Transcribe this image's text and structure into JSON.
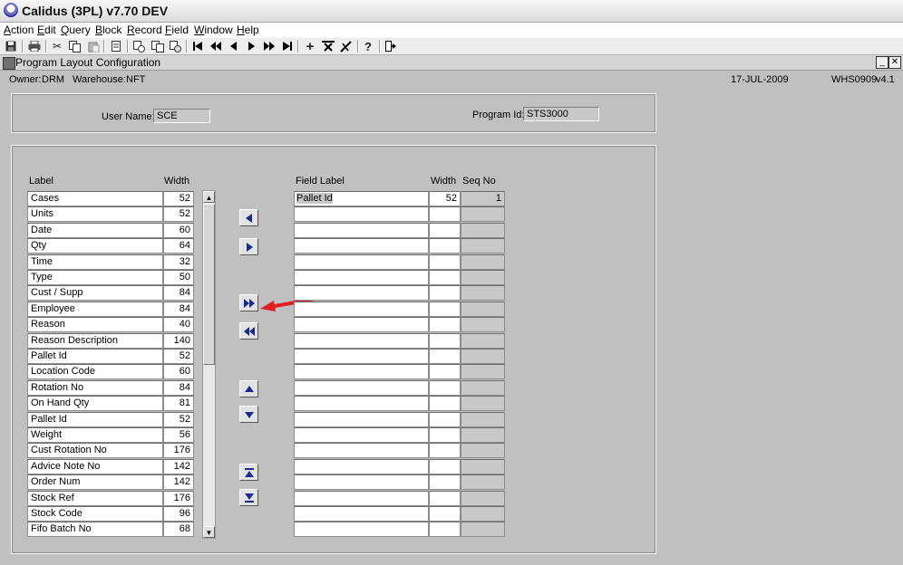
{
  "window": {
    "title": "Calidus (3PL) v7.70 DEV"
  },
  "menu": [
    "Action",
    "Edit",
    "Query",
    "Block",
    "Record",
    "Field",
    "Window",
    "Help"
  ],
  "toolbar_icons": [
    "save-icon",
    "print-icon",
    "cut-icon",
    "copy-icon",
    "paste-icon",
    "clear-icon",
    "duplicate-icon",
    "copy-record-icon",
    "paste-record-icon",
    "first-record-icon",
    "previous-set-icon",
    "previous-record-icon",
    "next-record-icon",
    "next-set-icon",
    "last-record-icon",
    "insert-record-icon",
    "delete-record-icon",
    "edit-icon",
    "help-icon",
    "exit-icon"
  ],
  "form": {
    "title": "Program Layout Configuration",
    "owner_label": "Owner:",
    "owner": "DRM",
    "warehouse_label": "Warehouse:",
    "warehouse": "NFT",
    "date": "17-JUL-2009",
    "form_id": "WHS0909",
    "version": "v4.1",
    "user_name_label": "User Name:",
    "user_name": "SCE",
    "program_id_label": "Program Id:",
    "program_id": "STS3000"
  },
  "available": {
    "headers": {
      "label": "Label",
      "width": "Width"
    },
    "rows": [
      {
        "label": "Cases",
        "width": "52"
      },
      {
        "label": "Units",
        "width": "52"
      },
      {
        "label": "Date",
        "width": "60"
      },
      {
        "label": "Qty",
        "width": "64"
      },
      {
        "label": "Time",
        "width": "32"
      },
      {
        "label": "Type",
        "width": "50"
      },
      {
        "label": "Cust / Supp",
        "width": "84"
      },
      {
        "label": "Employee",
        "width": "84"
      },
      {
        "label": "Reason",
        "width": "40"
      },
      {
        "label": "Reason Description",
        "width": "140"
      },
      {
        "label": "Pallet Id",
        "width": "52"
      },
      {
        "label": "Location Code",
        "width": "60"
      },
      {
        "label": "Rotation No",
        "width": "84"
      },
      {
        "label": "On Hand Qty",
        "width": "81"
      },
      {
        "label": "Pallet Id",
        "width": "52"
      },
      {
        "label": "Weight",
        "width": "56"
      },
      {
        "label": "Cust Rotation No",
        "width": "176"
      },
      {
        "label": "Advice Note No",
        "width": "142"
      },
      {
        "label": "Order Num",
        "width": "142"
      },
      {
        "label": "Stock Ref",
        "width": "176"
      },
      {
        "label": "Stock Code",
        "width": "96"
      },
      {
        "label": "Fifo Batch No",
        "width": "68"
      }
    ]
  },
  "selected": {
    "headers": {
      "label": "Field Label",
      "width": "Width",
      "seq": "Seq No"
    },
    "rows": [
      {
        "label": "Pallet Id",
        "width": "52",
        "seq": "1"
      },
      {
        "label": "",
        "width": "",
        "seq": ""
      },
      {
        "label": "",
        "width": "",
        "seq": ""
      },
      {
        "label": "",
        "width": "",
        "seq": ""
      },
      {
        "label": "",
        "width": "",
        "seq": ""
      },
      {
        "label": "",
        "width": "",
        "seq": ""
      },
      {
        "label": "",
        "width": "",
        "seq": ""
      },
      {
        "label": "",
        "width": "",
        "seq": ""
      },
      {
        "label": "",
        "width": "",
        "seq": ""
      },
      {
        "label": "",
        "width": "",
        "seq": ""
      },
      {
        "label": "",
        "width": "",
        "seq": ""
      },
      {
        "label": "",
        "width": "",
        "seq": ""
      },
      {
        "label": "",
        "width": "",
        "seq": ""
      },
      {
        "label": "",
        "width": "",
        "seq": ""
      },
      {
        "label": "",
        "width": "",
        "seq": ""
      },
      {
        "label": "",
        "width": "",
        "seq": ""
      },
      {
        "label": "",
        "width": "",
        "seq": ""
      },
      {
        "label": "",
        "width": "",
        "seq": ""
      },
      {
        "label": "",
        "width": "",
        "seq": ""
      },
      {
        "label": "",
        "width": "",
        "seq": ""
      },
      {
        "label": "",
        "width": "",
        "seq": ""
      },
      {
        "label": "",
        "width": "",
        "seq": ""
      }
    ]
  },
  "move_buttons": [
    "move-left-button",
    "move-right-button",
    "move-all-right-button",
    "move-all-left-button",
    "move-up-button",
    "move-down-button",
    "move-top-button",
    "move-bottom-button"
  ],
  "annotation": {
    "color": "#e02020",
    "points_to": "move-all-right-button"
  }
}
